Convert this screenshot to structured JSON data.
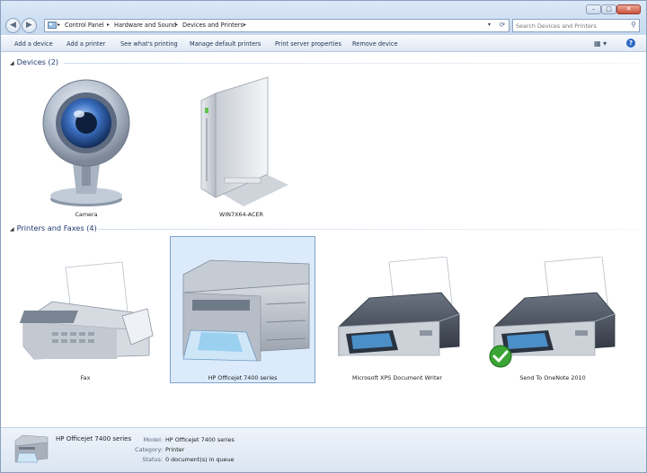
{
  "address": {
    "segments": [
      "Control Panel",
      "Hardware and Sound",
      "Devices and Printers"
    ]
  },
  "search": {
    "placeholder": "Search Devices and Printers"
  },
  "commands": [
    "Add a device",
    "Add a printer",
    "See what's printing",
    "Manage default printers",
    "Print server properties",
    "Remove device"
  ],
  "groups": {
    "devices": {
      "header": "Devices (2)",
      "items": [
        "Camera",
        "WIN7X64-ACER"
      ]
    },
    "printers": {
      "header": "Printers and Faxes (4)",
      "items": [
        "Fax",
        "HP Officejet 7400 series",
        "Microsoft XPS Document Writer",
        "Send To OneNote 2010"
      ]
    }
  },
  "details": {
    "title": "HP Officejet 7400 series",
    "model_label": "Model:",
    "model_value": "HP Officejet 7400 series",
    "category_label": "Category:",
    "category_value": "Printer",
    "status_label": "Status:",
    "status_value": "0 document(s) in queue"
  },
  "colors": {
    "selection": "#dcebfc",
    "selection_border": "#7da2ce",
    "header_text": "#1e3a6e"
  },
  "icons": [
    "back-arrow-icon",
    "forward-arrow-icon",
    "control-panel-icon",
    "refresh-icon",
    "search-icon",
    "view-options-icon",
    "help-icon",
    "camera-icon",
    "computer-tower-icon",
    "fax-icon",
    "multifunction-printer-icon",
    "printer-icon",
    "default-check-icon"
  ]
}
